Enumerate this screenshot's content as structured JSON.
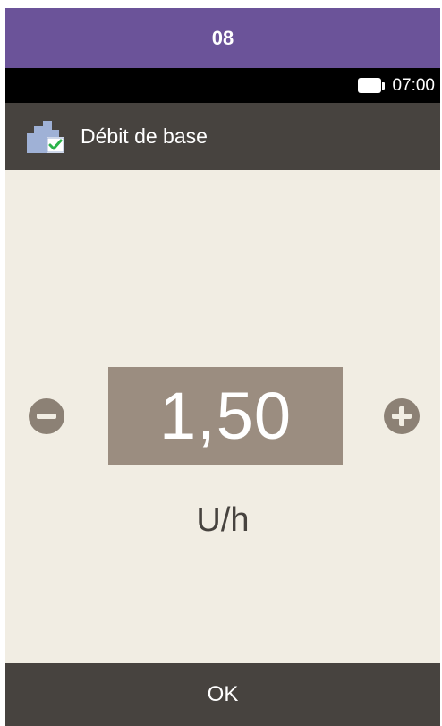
{
  "step": {
    "number": "08"
  },
  "status": {
    "time": "07:00",
    "battery_icon": "battery-full-icon"
  },
  "header": {
    "title": "Débit de base",
    "icon": "basal-rate-check-icon"
  },
  "rate": {
    "value": "1,50",
    "unit": "U/h",
    "decrease_icon": "minus-icon",
    "increase_icon": "plus-icon"
  },
  "footer": {
    "ok_label": "OK"
  },
  "colors": {
    "step_bar": "#6b5399",
    "title_bar": "#47433f",
    "background": "#f1ede3",
    "value_box": "#9b8d80",
    "buttons": "#8c8175",
    "check_green": "#2bb34a"
  }
}
